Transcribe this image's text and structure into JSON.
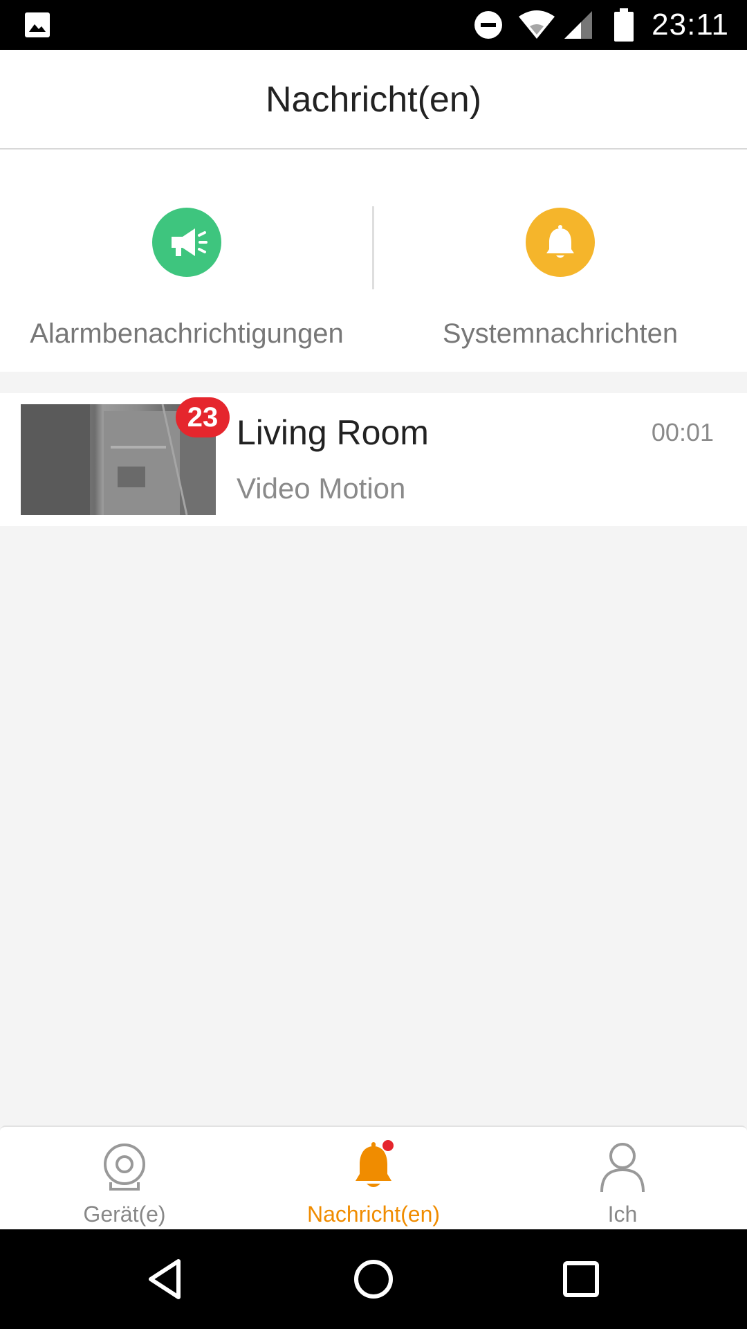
{
  "status_bar": {
    "time": "23:11",
    "icons": [
      "image-icon",
      "do-not-disturb-icon",
      "wifi-icon",
      "signal-icon",
      "battery-icon"
    ]
  },
  "header": {
    "title": "Nachricht(en)"
  },
  "categories": [
    {
      "label": "Alarmbenachrichtigungen",
      "icon": "megaphone-icon",
      "color": "#3ec57e"
    },
    {
      "label": "Systemnachrichten",
      "icon": "bell-icon",
      "color": "#f5b52b"
    }
  ],
  "messages": [
    {
      "device": "Living Room",
      "event": "Video Motion",
      "time": "00:01",
      "badge": "23"
    }
  ],
  "tabs": [
    {
      "label": "Gerät(e)",
      "icon": "camera-icon",
      "active": false
    },
    {
      "label": "Nachricht(en)",
      "icon": "bell-icon",
      "active": true
    },
    {
      "label": "Ich",
      "icon": "person-icon",
      "active": false
    }
  ],
  "colors": {
    "accent": "#f08c00",
    "badge": "#e5262d",
    "alarm": "#3ec57e",
    "system": "#f5b52b"
  },
  "nav_bar": {
    "buttons": [
      "back-button",
      "home-button",
      "recents-button"
    ]
  }
}
